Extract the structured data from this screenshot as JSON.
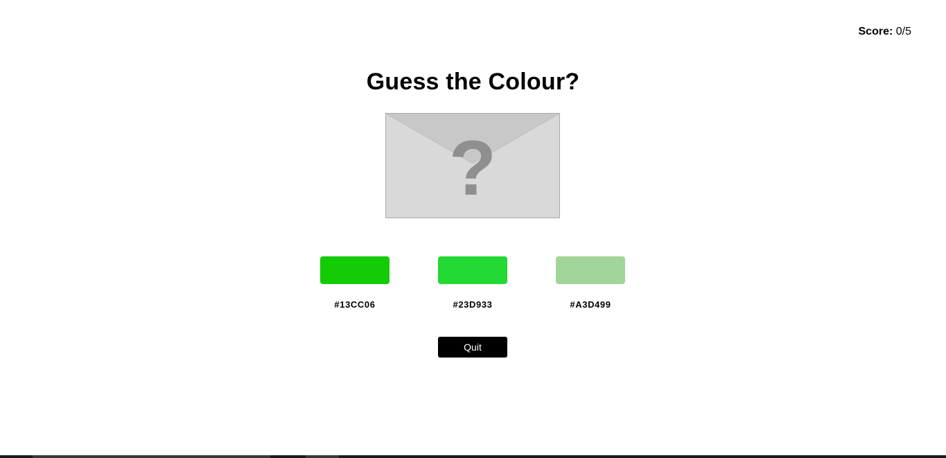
{
  "score": {
    "label": "Score:",
    "value": "0/5"
  },
  "title": "Guess the Colour?",
  "mystery": {
    "icon": "question-mark-envelope-icon",
    "glyph": "?"
  },
  "options": [
    {
      "hex": "#13CC06",
      "color": "#13CC06"
    },
    {
      "hex": "#23D933",
      "color": "#23D933"
    },
    {
      "hex": "#A3D499",
      "color": "#A3D499"
    }
  ],
  "quit_label": "Quit"
}
